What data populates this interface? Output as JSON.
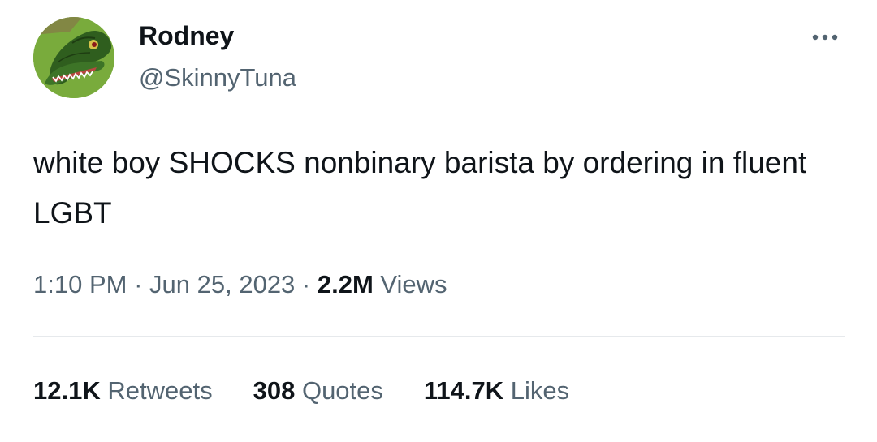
{
  "author": {
    "name": "Rodney",
    "handle": "@SkinnyTuna",
    "avatar_icon": "green-lizard-avatar-icon"
  },
  "more_icon": "more-horizontal-icon",
  "tweet": {
    "text": "white boy SHOCKS nonbinary barista by ordering in fluent LGBT",
    "time": "1:10 PM",
    "separator": "·",
    "date": "Jun 25, 2023",
    "views_count": "2.2M",
    "views_label": "Views"
  },
  "stats": {
    "retweets": {
      "count": "12.1K",
      "label": "Retweets"
    },
    "quotes": {
      "count": "308",
      "label": "Quotes"
    },
    "likes": {
      "count": "114.7K",
      "label": "Likes"
    }
  },
  "colors": {
    "text_primary": "#0f1419",
    "text_secondary": "#536471",
    "divider": "#e6e9ec",
    "avatar_bg": "#77a93b"
  }
}
